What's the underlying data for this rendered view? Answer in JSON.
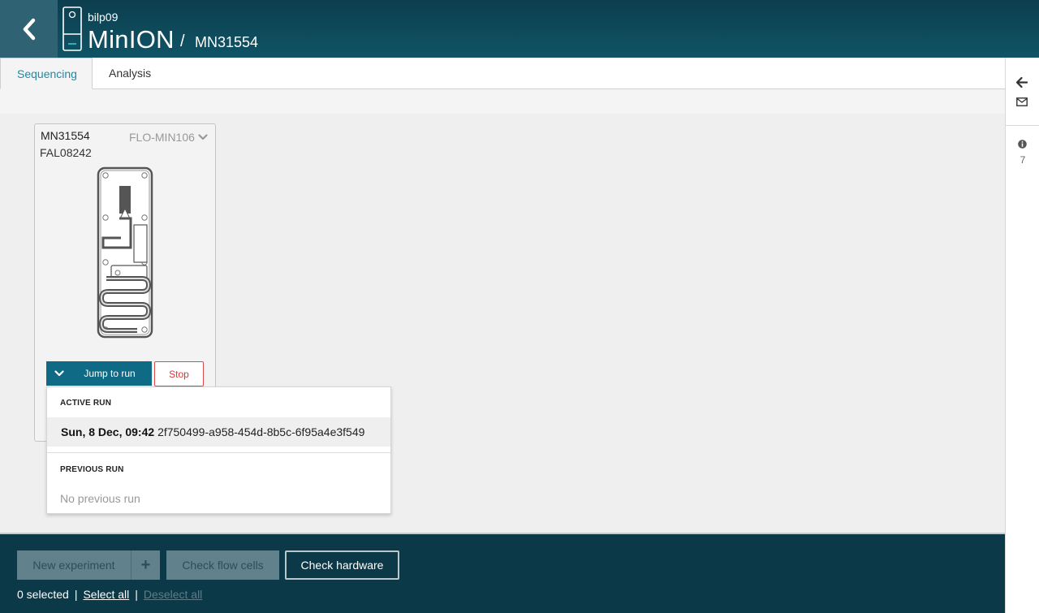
{
  "header": {
    "host": "bilp09",
    "device_type": "MinION",
    "separator": "/",
    "device_id": "MN31554"
  },
  "tabs": [
    {
      "label": "Sequencing",
      "active": true
    },
    {
      "label": "Analysis",
      "active": false
    }
  ],
  "rail": {
    "info_count": "7",
    "icons": [
      "arrow-left-icon",
      "envelope-icon",
      "info-icon"
    ]
  },
  "card": {
    "position_id": "MN31554",
    "flow_cell_id": "FAL08242",
    "flow_cell_type": "FLO-MIN106",
    "jump_label": "Jump to run",
    "stop_label": "Stop"
  },
  "dropdown": {
    "active_heading": "ACTIVE RUN",
    "active_run_date": "Sun, 8 Dec, 09:42",
    "active_run_id": "2f750499-a958-454d-8b5c-6f95a4e3f549",
    "previous_heading": "PREVIOUS RUN",
    "previous_none": "No previous run"
  },
  "footer": {
    "new_experiment": "New experiment",
    "new_plus": "+",
    "check_flow_cells": "Check flow cells",
    "check_hardware": "Check hardware",
    "selected_count": "0 selected",
    "select_all": "Select all",
    "deselect_all": "Deselect all",
    "divider": "|"
  },
  "colors": {
    "header_bg": "#0f5466",
    "accent": "#1e8aa6",
    "primary_button": "#0f6b85",
    "stop_red": "#d33",
    "footer_bg": "#0b3948"
  }
}
